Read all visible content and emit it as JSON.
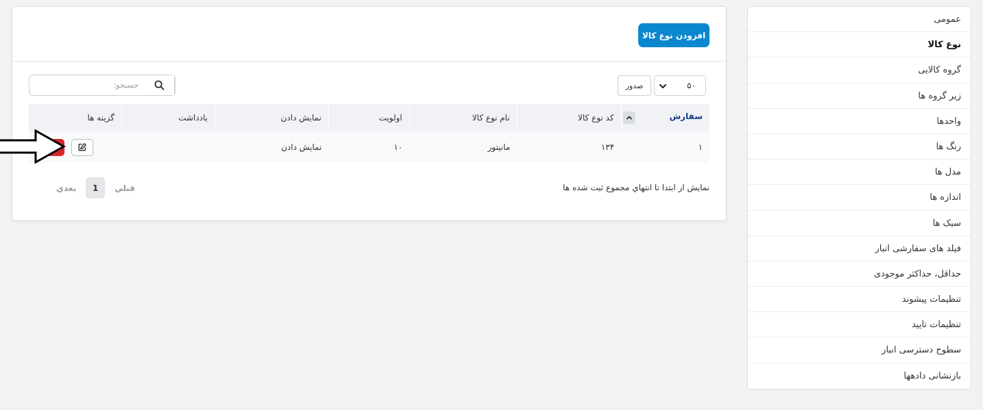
{
  "sidebar": {
    "items": [
      {
        "label": "عمومی"
      },
      {
        "label": "نوع کالا"
      },
      {
        "label": "گروه کالایی"
      },
      {
        "label": "زیر گروه ها"
      },
      {
        "label": "واحدها"
      },
      {
        "label": "رنگ ها"
      },
      {
        "label": "مدل ها"
      },
      {
        "label": "اندازه ها"
      },
      {
        "label": "سبک ها"
      },
      {
        "label": "فیلد های سفارشی انبار"
      },
      {
        "label": "حداقل، حداکثر موجودی"
      },
      {
        "label": "تنظیمات پیشوند"
      },
      {
        "label": "تنظیمات تایید"
      },
      {
        "label": "سطوح دسترسی انبار"
      },
      {
        "label": "بازنشانی دادهها"
      }
    ],
    "active": "نوع کالا"
  },
  "header": {
    "add_label": "افزودن نوع کالا"
  },
  "toolbar": {
    "page_size": "۵۰",
    "export_label": "صدور",
    "search_placeholder": "جستجو:"
  },
  "table": {
    "columns": [
      "سفارش",
      "کد نوع کالا",
      "نام نوع کالا",
      "اولویت",
      "نمایش دادن",
      "یادداشت",
      "گزینه ها"
    ],
    "rows": [
      {
        "order": "۱",
        "code": "۱۳۴",
        "name": "مانیتور",
        "priority": "۱۰",
        "display": "نمایش دادن",
        "note": ""
      }
    ]
  },
  "footer": {
    "info": "نمایش از ابتدا تا انتهاي مجموع ثبت شده ها",
    "prev_label": "قبلي",
    "current_page": "1",
    "next_label": "بعدي"
  },
  "colors": {
    "primary": "#0a87cf",
    "danger": "#d9262e",
    "sort_header": "#1a3a8a"
  },
  "icons": {
    "search": "search-icon",
    "edit": "edit-icon",
    "delete": "close-icon",
    "sort": "chevron-up-icon",
    "select": "chevron-down-icon",
    "annotation": "arrow-right-icon"
  }
}
